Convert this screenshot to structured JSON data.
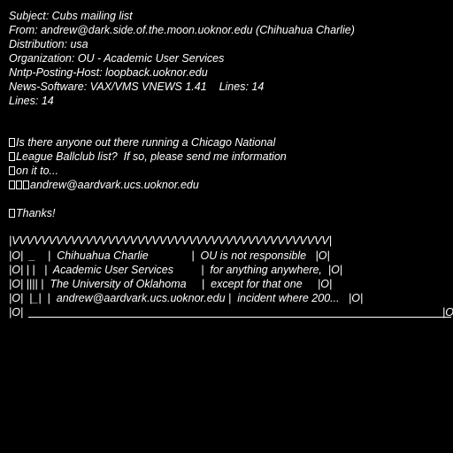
{
  "header": {
    "subject": "Subject: Cubs mailing list",
    "from": "From: andrew@dark.side.of.the.moon.uoknor.edu (Chihuahua Charlie)",
    "distribution": "Distribution: usa",
    "organization": "Organization: OU - Academic User Services",
    "nntp_posting_host": "Nntp-Posting-Host: loopback.uoknor.edu",
    "news_software": "News-Software: VAX/VMS VNEWS 1.41    Lines: 14",
    "lines": "Lines: 14"
  },
  "body": {
    "paragraph_1": [
      "Is there anyone out there running a Chicago National",
      "League Ballclub list?  If so, please send me information",
      "on it to...",
      "andrew@aardvark.ucs.uoknor.edu"
    ],
    "closing": "Thanks!"
  },
  "signature": {
    "top_border": "|VVVVVVVVVVVVVVVVVVVVVVVVVVVVVVVVVVVVVVVVVVV|",
    "lines": [
      "|O|  _    |  Chihuahua Charlie              |  OU is not responsible   |O|",
      "|O| | |   |  Academic User Services         |  for anything anywhere,  |O|",
      "|O| |||| |  The University of Oklahoma     |  except for that one     |O|",
      "|O|  |_|  |  andrew@aardvark.ucs.uoknor.edu |  incident where 200...   |O|"
    ],
    "bottom_left": "|O|",
    "bottom_right": "|O"
  },
  "colors": {
    "background": "#000000",
    "text": "#ffffff"
  }
}
